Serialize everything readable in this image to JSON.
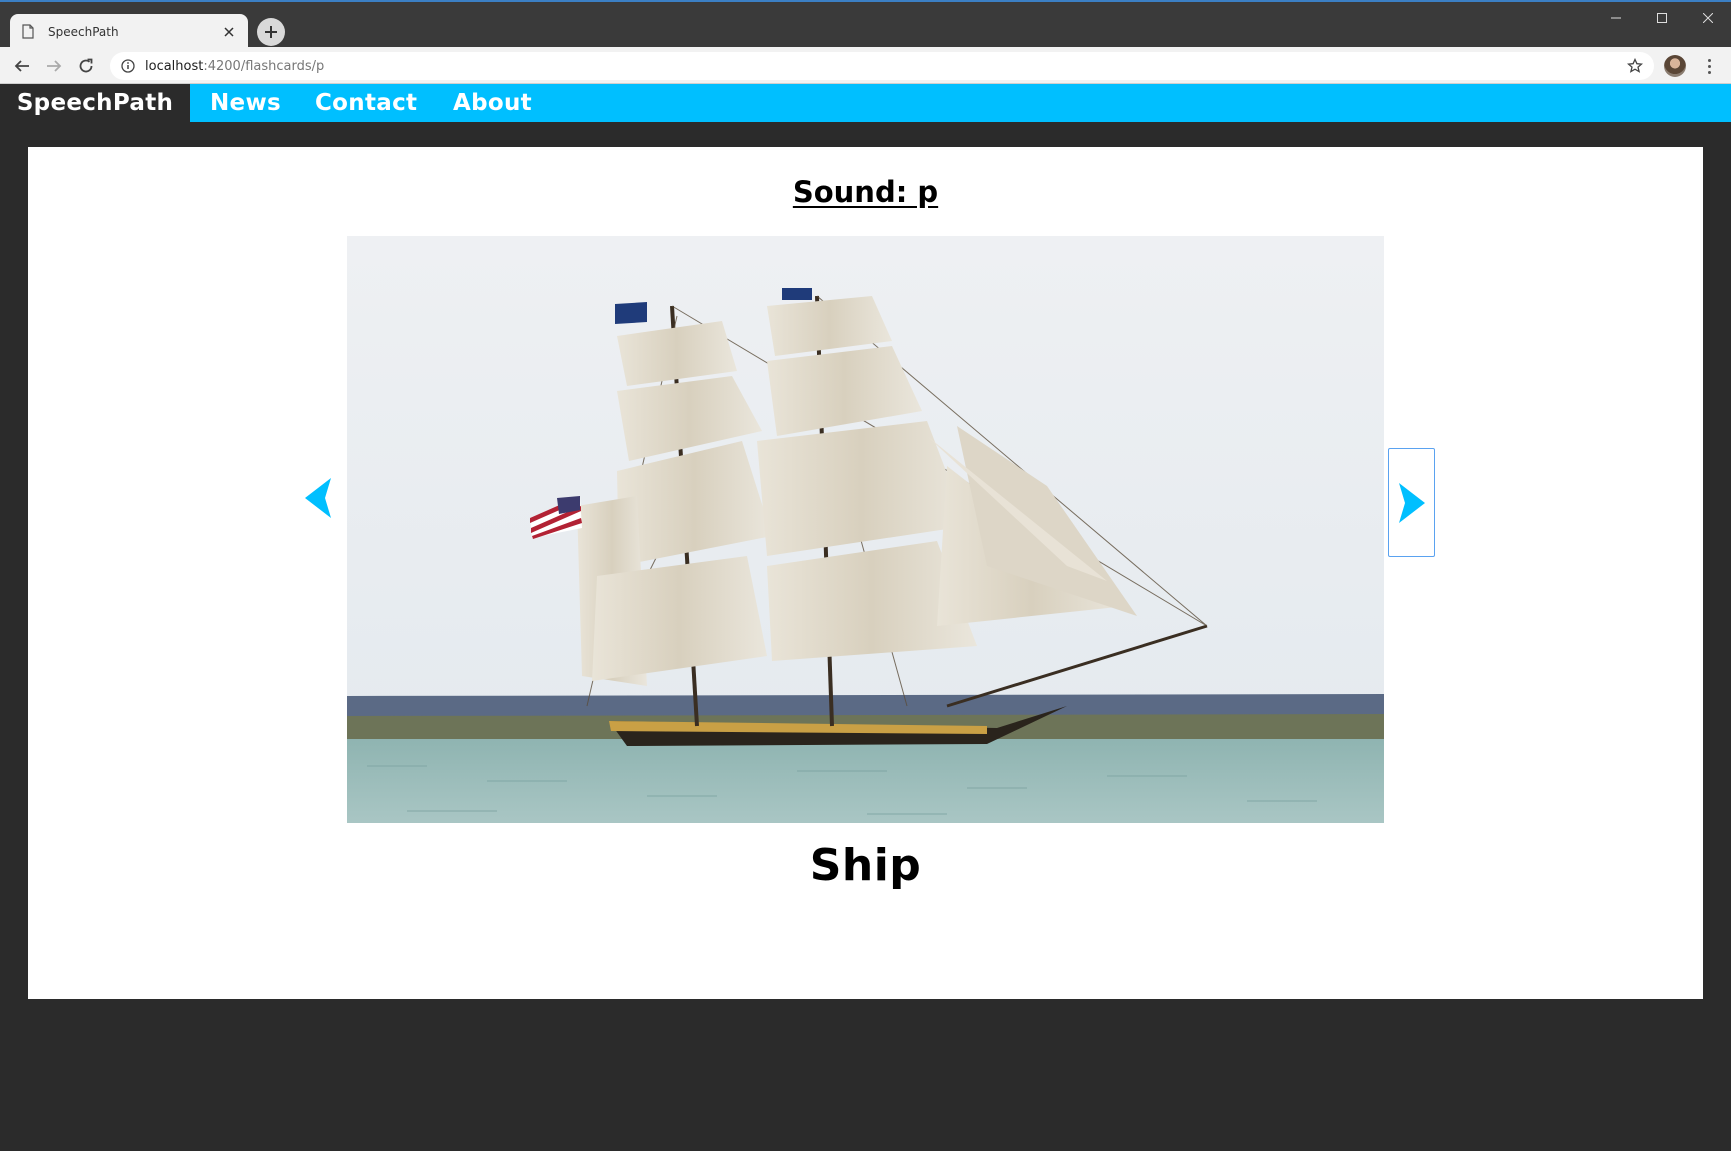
{
  "browser": {
    "tab_title": "SpeechPath",
    "url_host": "localhost",
    "url_path": ":4200/flashcards/p"
  },
  "site": {
    "brand": "SpeechPath",
    "nav": [
      "News",
      "Contact",
      "About"
    ]
  },
  "flashcard": {
    "sound_label": "Sound: p",
    "word": "Ship"
  },
  "colors": {
    "accent": "#00bfff",
    "page_bg": "#2b2b2b",
    "card_bg": "#ffffff"
  }
}
